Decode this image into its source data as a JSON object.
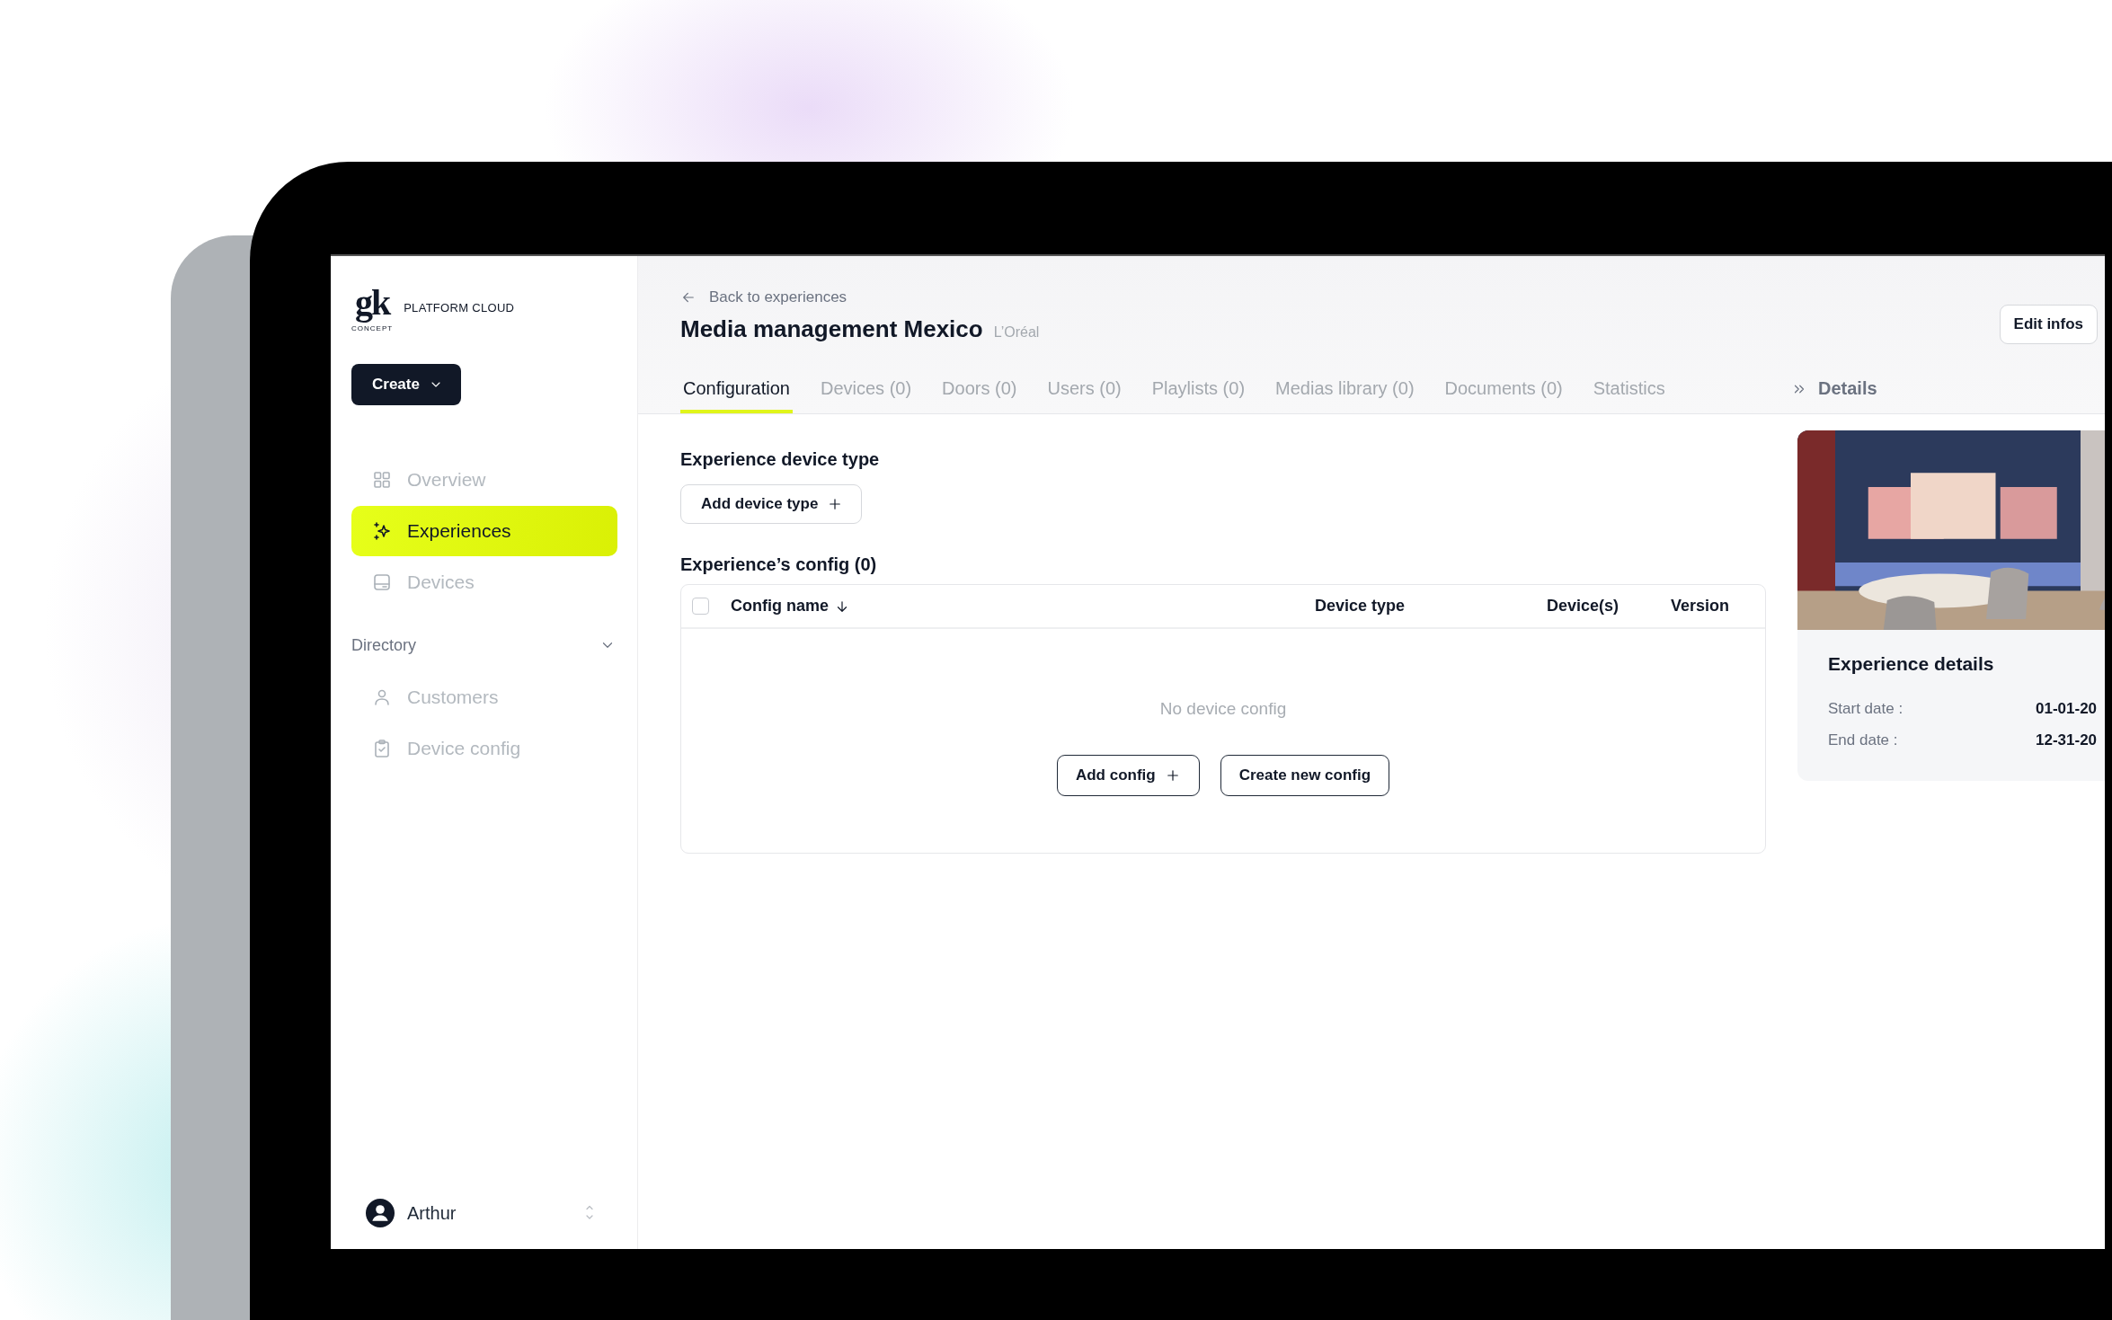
{
  "brand": {
    "logo": "gk",
    "logo_sub": "CONCEPT",
    "product": "PLATFORM CLOUD"
  },
  "create_button": {
    "label": "Create"
  },
  "nav": [
    {
      "label": "Overview",
      "selected": false
    },
    {
      "label": "Experiences",
      "selected": true
    },
    {
      "label": "Devices",
      "selected": false
    }
  ],
  "directory": {
    "label": "Directory",
    "expanded": true,
    "items": [
      {
        "label": "Customers",
        "selected": false
      },
      {
        "label": "Device config",
        "selected": false
      }
    ]
  },
  "user": {
    "name": "Arthur"
  },
  "header": {
    "back_link": "Back to experiences",
    "title": "Media management Mexico",
    "client": "L’Oréal",
    "edit_button": "Edit infos"
  },
  "tabs": [
    {
      "label": "Configuration",
      "selected": true
    },
    {
      "label": "Devices (0)",
      "selected": false
    },
    {
      "label": "Doors (0)",
      "selected": false
    },
    {
      "label": "Users (0)",
      "selected": false
    },
    {
      "label": "Playlists (0)",
      "selected": false
    },
    {
      "label": "Medias library (0)",
      "selected": false
    },
    {
      "label": "Documents (0)",
      "selected": false
    },
    {
      "label": "Statistics",
      "selected": false
    }
  ],
  "details_toggle": {
    "label": "Details"
  },
  "device_type_section": {
    "heading": "Experience device type",
    "add_button": "Add device type"
  },
  "config_section": {
    "heading": "Experience’s config (0)",
    "table": {
      "select_all_checked": false,
      "columns": [
        {
          "label": "Config name",
          "sorted": true
        },
        {
          "label": "Device type",
          "sorted": false
        },
        {
          "label": "Device(s)",
          "sorted": false
        },
        {
          "label": "Version",
          "sorted": false
        }
      ],
      "empty_text": "No device config",
      "buttons": [
        {
          "label": "Add config",
          "kind": "add"
        },
        {
          "label": "Create new config",
          "kind": "plain"
        }
      ]
    }
  },
  "details_card": {
    "heading": "Experience details",
    "fields": [
      {
        "label": "Start date :",
        "value": "01-01-20"
      },
      {
        "label": "End date :",
        "value": "12-31-20"
      }
    ]
  }
}
